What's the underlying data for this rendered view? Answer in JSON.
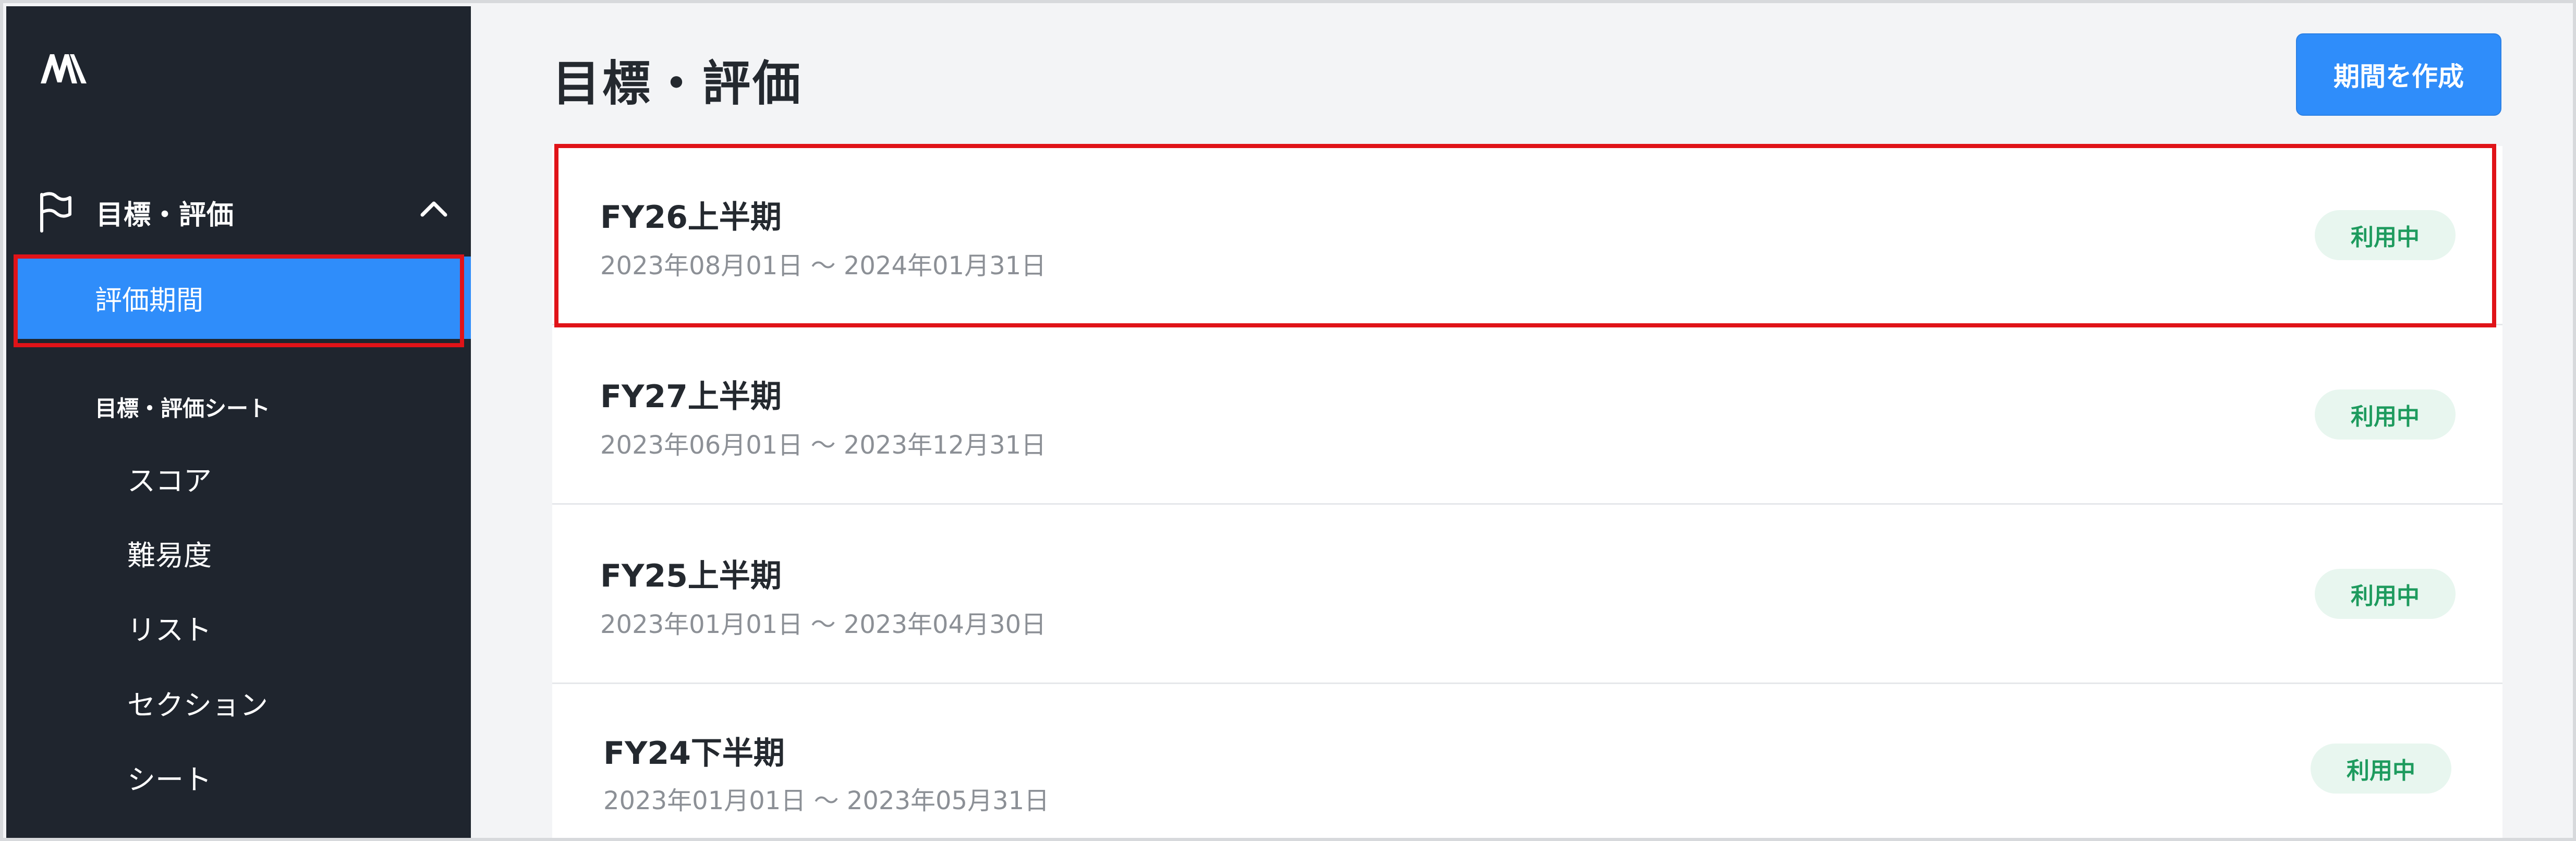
{
  "sidebar": {
    "logo_icon": "brand-logo-icon",
    "section": {
      "label": "目標・評価",
      "icon": "flag-icon",
      "toggle_icon": "chevron-up-icon"
    },
    "active_item": {
      "label": "評価期間"
    },
    "group_title": "目標・評価シート",
    "sub_items": [
      {
        "label": "スコア"
      },
      {
        "label": "難易度"
      },
      {
        "label": "リスト"
      },
      {
        "label": "セクション"
      },
      {
        "label": "シート"
      }
    ]
  },
  "header": {
    "title": "目標・評価",
    "create_button": "期間を作成"
  },
  "periods": [
    {
      "name": "FY26上半期",
      "range": "2023年08月01日 〜 2024年01月31日",
      "status": "利用中"
    },
    {
      "name": "FY27上半期",
      "range": "2023年06月01日 〜 2023年12月31日",
      "status": "利用中"
    },
    {
      "name": "FY25上半期",
      "range": "2023年01月01日 〜 2023年04月30日",
      "status": "利用中"
    },
    {
      "name": "FY24下半期",
      "range": "2023年01月01日 〜 2023年05月31日",
      "status": "利用中"
    }
  ],
  "colors": {
    "sidebar_bg": "#1f252e",
    "accent": "#2f8dfa",
    "highlight": "#e01318",
    "status_bg": "#e8f6ef",
    "status_text": "#1e9b5e"
  }
}
